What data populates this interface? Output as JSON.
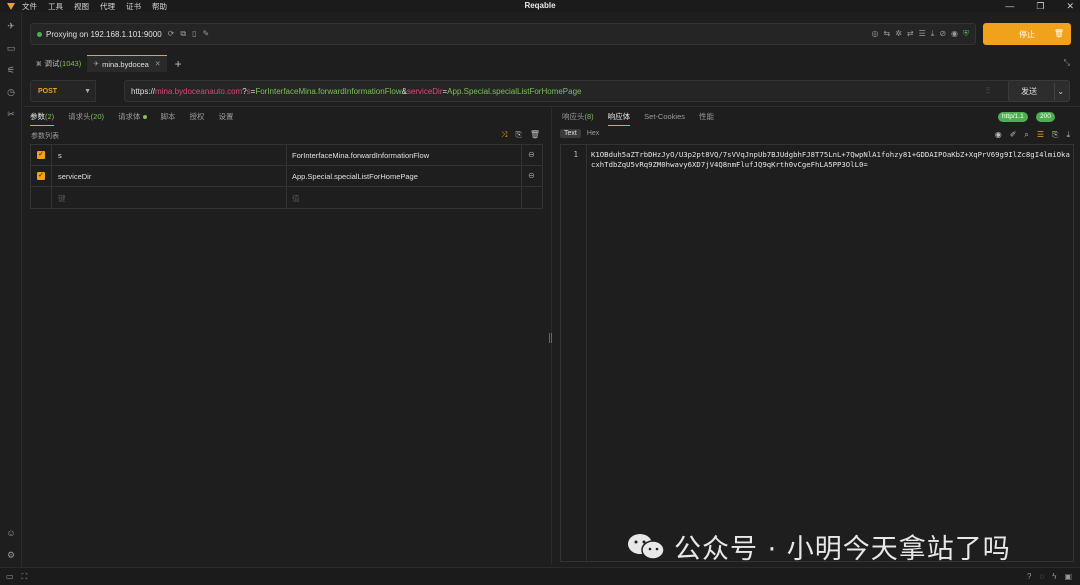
{
  "app": {
    "title": "Reqable",
    "brand_color": "#f0a21a",
    "accent_green": "#7fbf5a"
  },
  "menu": [
    "文件",
    "工具",
    "视图",
    "代理",
    "证书",
    "帮助"
  ],
  "proxy": {
    "status": "Proxying on 192.168.1.101:9000"
  },
  "stop_button": {
    "label": "停止"
  },
  "tabs": [
    {
      "label": "调试",
      "count": "(1043)"
    },
    {
      "label": "mina.bydocea"
    }
  ],
  "request": {
    "method": "POST",
    "url_scheme": "https://",
    "url_host": "mina.bydoceanauto.com",
    "url_q": "?",
    "param1_key": "s",
    "eq": "=",
    "param1_val": "ForInterfaceMina.forwardInformationFlow",
    "amp": "&",
    "param2_key": "serviceDir",
    "param2_val": "App.Special.specialListForHomePage",
    "send_label": "发送"
  },
  "left_panel": {
    "tabs": [
      {
        "label": "参数",
        "count": "(2)"
      },
      {
        "label": "请求头",
        "count": "(20)"
      },
      {
        "label": "请求体"
      },
      {
        "label": "脚本"
      },
      {
        "label": "授权"
      },
      {
        "label": "设置"
      }
    ],
    "section_label": "参数列表",
    "params": [
      {
        "key": "s",
        "value": "ForInterfaceMina.forwardInformationFlow"
      },
      {
        "key": "serviceDir",
        "value": "App.Special.specialListForHomePage"
      }
    ],
    "placeholder_key": "键",
    "placeholder_value": "值"
  },
  "right_panel": {
    "tabs": [
      {
        "label": "响应头",
        "count": "(8)"
      },
      {
        "label": "响应体"
      },
      {
        "label": "Set-Cookies"
      },
      {
        "label": "性能"
      }
    ],
    "http_badge": "http/1.1",
    "status_badge": "200",
    "view_modes": [
      "Text",
      "Hex"
    ],
    "line_number": "1",
    "body": "K1OBduh5aZTrbDHzJyO/U3p2pt8VQ/7sVVqJnpUb7BJUdgbhFJ8T75LnL+7QwpNlA1fohzy81+GDDAIPOaKbZ+XqPrV69g9IlZc8gI4lmiOkacxhTdbZqU5vRq9ZM0hwavy6XD7jV4Q8nmFlufJQ9qKrth0vCgeFhLA5PP3OlL0="
  },
  "watermark": {
    "text": "公众号 · 小明今天拿站了吗"
  }
}
